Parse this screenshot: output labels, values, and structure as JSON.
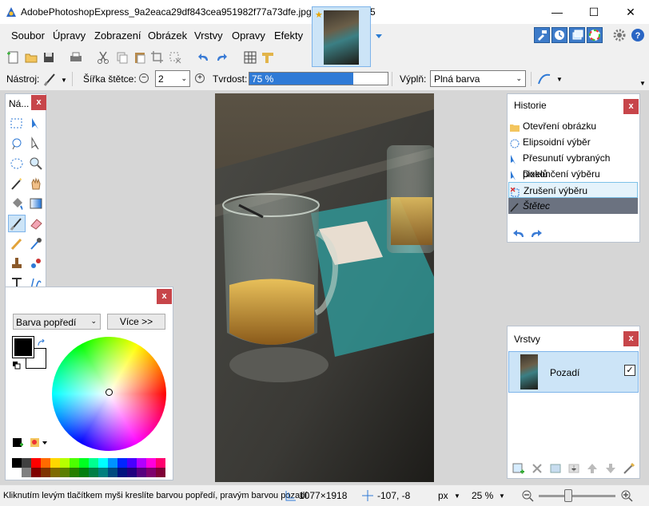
{
  "window": {
    "title": "AdobePhotoshopExpress_9a2eaca29df843cea951982f77a73dfe.jpg-paint.net 4.0.5",
    "minimize": "—",
    "maximize": "☐",
    "close": "✕"
  },
  "menu": [
    "Soubor",
    "Úpravy",
    "Zobrazení",
    "Obrázek",
    "Vrstvy",
    "Opravy",
    "Efekty"
  ],
  "toolbar2": {
    "tool_label": "Nástroj:",
    "brush_width_label": "Šířka štětce:",
    "brush_width_value": "2",
    "hardness_label": "Tvrdost:",
    "hardness_value": "75 %",
    "hardness_fraction": 0.75,
    "fill_label": "Výplň:",
    "fill_value": "Plná barva"
  },
  "tools_panel": {
    "title": "Ná...",
    "close": "x"
  },
  "history_panel": {
    "title": "Historie",
    "close": "x",
    "items": [
      {
        "label": "Otevření obrázku",
        "icon": "folder-icon",
        "state": "normal"
      },
      {
        "label": "Elipsoidní výběr",
        "icon": "ellipse-select-icon",
        "state": "normal"
      },
      {
        "label": "Přesunutí vybraných pixelů",
        "icon": "move-pixels-icon",
        "state": "normal"
      },
      {
        "label": "Dokončení výběru",
        "icon": "finish-selection-icon",
        "state": "normal"
      },
      {
        "label": "Zrušení výběru",
        "icon": "deselect-icon",
        "state": "highlight"
      },
      {
        "label": "Štětec",
        "icon": "brush-icon",
        "state": "selected"
      }
    ]
  },
  "layers_panel": {
    "title": "Vrstvy",
    "close": "x",
    "layer_name": "Pozadí",
    "layer_visible": true
  },
  "colors_panel": {
    "close": "x",
    "mode_select": "Barva popředí",
    "more_button": "Více >>",
    "primary": "#000000",
    "secondary": "#ffffff",
    "palette_row1": [
      "#000000",
      "#404040",
      "#ff0000",
      "#ff6a00",
      "#ffd800",
      "#b6ff00",
      "#4cff00",
      "#00ff21",
      "#00ff90",
      "#00ffff",
      "#0094ff",
      "#0026ff",
      "#4800ff",
      "#b200ff",
      "#ff00dc",
      "#ff006e"
    ],
    "palette_row2": [
      "#ffffff",
      "#808080",
      "#7f0000",
      "#7f3300",
      "#7f6a00",
      "#5b7f00",
      "#267f00",
      "#007f0e",
      "#007f46",
      "#007f7f",
      "#004a7f",
      "#00137f",
      "#21007f",
      "#57007f",
      "#7f006e",
      "#7f0037"
    ]
  },
  "statusbar": {
    "hint": "Kliknutím levým tlačítkem myši kreslíte barvou popředí, pravým barvou pozadí.",
    "image_size": "1077×1918",
    "cursor_pos": "-107, -8",
    "units": "px",
    "zoom": "25 %",
    "zoom_fraction": 0.25
  }
}
